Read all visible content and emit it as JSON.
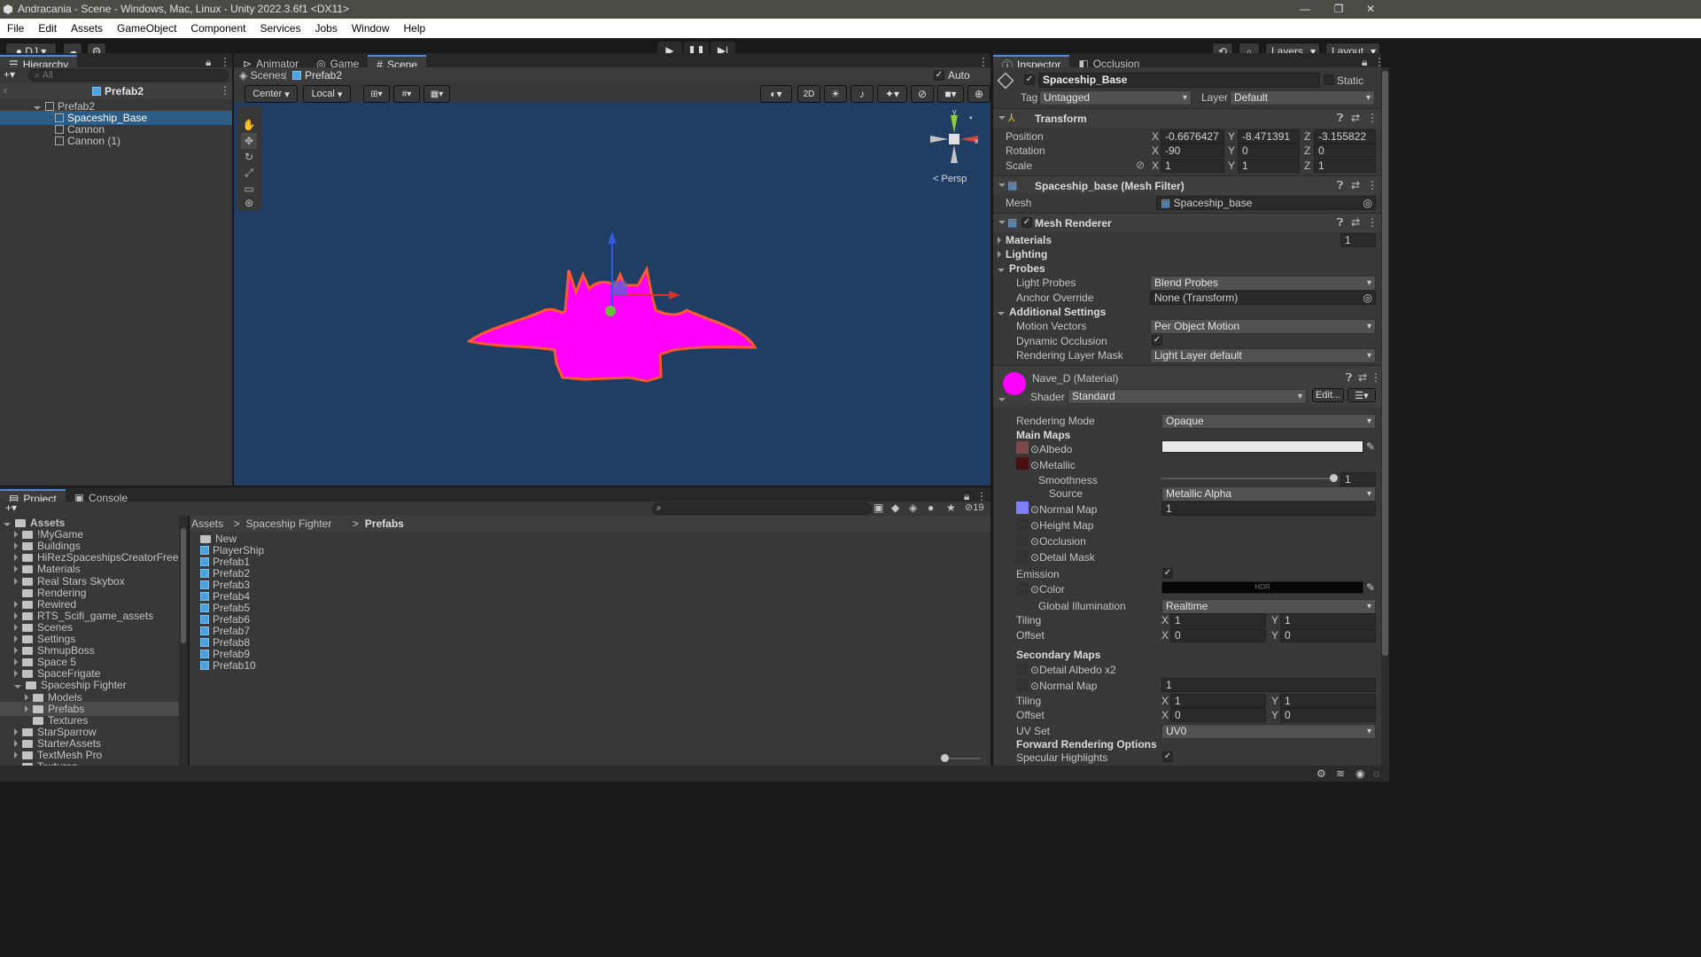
{
  "window": {
    "title": "Andracania - Scene - Windows, Mac, Linux - Unity 2022.3.6f1 <DX11>"
  },
  "menu": [
    "File",
    "Edit",
    "Assets",
    "GameObject",
    "Component",
    "Services",
    "Jobs",
    "Window",
    "Help"
  ],
  "toolbar": {
    "account": "DJ",
    "layers": "Layers",
    "layout": "Layout"
  },
  "hierarchy": {
    "tab": "Hierarchy",
    "search_placeholder": "All",
    "root": "Prefab2",
    "items": [
      {
        "label": "Prefab2"
      },
      {
        "label": "Spaceship_Base"
      },
      {
        "label": "Cannon"
      },
      {
        "label": "Cannon (1)"
      }
    ]
  },
  "sceneTabs": {
    "animator": "Animator",
    "game": "Game",
    "scene": "Scene"
  },
  "sceneBar": {
    "scenes": "Scenes",
    "prefab": "Prefab2",
    "autosave": "Auto Save"
  },
  "sceneToolbar": {
    "pivot": "Center",
    "space": "Local",
    "mode2d": "2D",
    "persp": "Persp"
  },
  "colors": {
    "sceneBg": "#203d64",
    "ship": "#ff00ff",
    "shipOutline": "#ff5a2e",
    "selection": "#2c5d87",
    "accent": "#4f8ad9"
  },
  "project": {
    "tab": "Project",
    "console": "Console",
    "hidden_count": "19",
    "breadcrumb": [
      "Assets",
      "Spaceship Fighter",
      "Prefabs"
    ],
    "tree": [
      {
        "label": "Assets",
        "lvl": 0
      },
      {
        "label": "!MyGame",
        "lvl": 1
      },
      {
        "label": "Buildings",
        "lvl": 1
      },
      {
        "label": "HiRezSpaceshipsCreatorFree",
        "lvl": 1
      },
      {
        "label": "Materials",
        "lvl": 1
      },
      {
        "label": "Real Stars Skybox",
        "lvl": 1
      },
      {
        "label": "Rendering",
        "lvl": 1
      },
      {
        "label": "Rewired",
        "lvl": 1
      },
      {
        "label": "RTS_Scifi_game_assets",
        "lvl": 1
      },
      {
        "label": "Scenes",
        "lvl": 1
      },
      {
        "label": "Settings",
        "lvl": 1
      },
      {
        "label": "ShmupBoss",
        "lvl": 1
      },
      {
        "label": "Space 5",
        "lvl": 1
      },
      {
        "label": "SpaceFrigate",
        "lvl": 1
      },
      {
        "label": "Spaceship Fighter",
        "lvl": 1
      },
      {
        "label": "Models",
        "lvl": 2
      },
      {
        "label": "Prefabs",
        "lvl": 2
      },
      {
        "label": "Textures",
        "lvl": 2
      },
      {
        "label": "StarSparrow",
        "lvl": 1
      },
      {
        "label": "StarterAssets",
        "lvl": 1
      },
      {
        "label": "TextMesh Pro",
        "lvl": 1
      },
      {
        "label": "Textures",
        "lvl": 1
      }
    ],
    "files": [
      "New",
      "PlayerShip",
      "Prefab1",
      "Prefab2",
      "Prefab3",
      "Prefab4",
      "Prefab5",
      "Prefab6",
      "Prefab7",
      "Prefab8",
      "Prefab9",
      "Prefab10"
    ]
  },
  "inspector": {
    "tab": "Inspector",
    "occlusion": "Occlusion",
    "name": "Spaceship_Base",
    "static": "Static",
    "tagLabel": "Tag",
    "tag": "Untagged",
    "layerLabel": "Layer",
    "layer": "Default",
    "transform": {
      "title": "Transform",
      "position": "Position",
      "rotation": "Rotation",
      "scale": "Scale",
      "px": "-0.6676427",
      "py": "-8.471391",
      "pz": "-3.155822",
      "rx": "-90",
      "ry": "0",
      "rz": "0",
      "sx": "1",
      "sy": "1",
      "sz": "1"
    },
    "meshFilter": {
      "title": "Spaceship_base (Mesh Filter)",
      "meshLabel": "Mesh",
      "mesh": "Spaceship_base"
    },
    "meshRenderer": {
      "title": "Mesh Renderer",
      "materials": "Materials",
      "materialsCount": "1",
      "lighting": "Lighting",
      "probes": "Probes",
      "lightProbes": "Light Probes",
      "lightProbesVal": "Blend Probes",
      "anchor": "Anchor Override",
      "anchorVal": "None (Transform)",
      "additional": "Additional Settings",
      "motion": "Motion Vectors",
      "motionVal": "Per Object Motion",
      "dynOcc": "Dynamic Occlusion",
      "renderMask": "Rendering Layer Mask",
      "renderMaskVal": "Light Layer default"
    },
    "material": {
      "title": "Nave_D (Material)",
      "shaderLabel": "Shader",
      "shader": "Standard",
      "edit": "Edit...",
      "renderMode": "Rendering Mode",
      "renderModeVal": "Opaque",
      "mainMaps": "Main Maps",
      "albedo": "Albedo",
      "metallic": "Metallic",
      "smoothness": "Smoothness",
      "smoothnessVal": "1",
      "source": "Source",
      "sourceVal": "Metallic Alpha",
      "normal": "Normal Map",
      "normalVal": "1",
      "height": "Height Map",
      "occl": "Occlusion",
      "detailMask": "Detail Mask",
      "emission": "Emission",
      "color": "Color",
      "hdr": "HDR",
      "gi": "Global Illumination",
      "giVal": "Realtime",
      "tiling": "Tiling",
      "offset": "Offset",
      "tx": "1",
      "ty": "1",
      "ox": "0",
      "oy": "0",
      "secondary": "Secondary Maps",
      "detailAlbedo": "Detail Albedo x2",
      "normal2": "Normal Map",
      "normal2Val": "1",
      "tx2": "1",
      "ty2": "1",
      "ox2": "0",
      "oy2": "0",
      "uvset": "UV Set",
      "uvsetVal": "UV0",
      "forward": "Forward Rendering Options",
      "specular": "Specular Highlights"
    }
  }
}
